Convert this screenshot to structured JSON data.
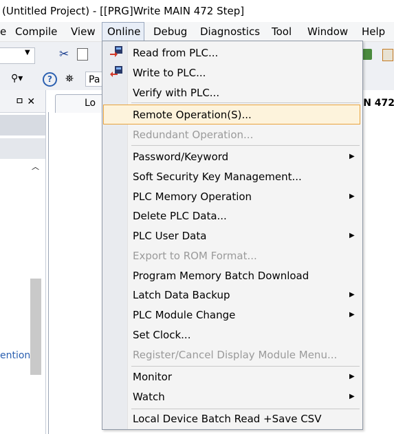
{
  "window": {
    "title": "(Untitled Project) - [[PRG]Write MAIN 472 Step]"
  },
  "menubar": {
    "items": [
      {
        "label": "e",
        "underline": ""
      },
      {
        "label": "Compile",
        "underline": "C"
      },
      {
        "label": "View",
        "underline": "V"
      },
      {
        "label": "Online",
        "underline": "O"
      },
      {
        "label": "Debug",
        "underline": "b"
      },
      {
        "label": "Diagnostics",
        "underline": "D"
      },
      {
        "label": "Tool",
        "underline": "T"
      },
      {
        "label": "Window",
        "underline": "W"
      },
      {
        "label": "Help",
        "underline": "H"
      }
    ]
  },
  "toolbar": {
    "pa_text": "Pa"
  },
  "editor": {
    "left_tab_label": "Lo",
    "right_tab_label": "IN 472"
  },
  "left_pane": {
    "header_icons": "ㅁ ✕",
    "partial_text": "ention"
  },
  "online_menu": [
    {
      "label": "Read from PLC...",
      "type": "item",
      "disabled": false,
      "submenu": false,
      "icon": "read-from-plc-icon"
    },
    {
      "label": "Write to PLC...",
      "type": "item",
      "disabled": false,
      "submenu": false,
      "icon": "write-to-plc-icon"
    },
    {
      "label": "Verify with PLC...",
      "type": "item",
      "disabled": false,
      "submenu": false,
      "icon": ""
    },
    {
      "type": "separator"
    },
    {
      "label": "Remote Operation(S)...",
      "type": "item",
      "disabled": false,
      "submenu": false,
      "highlighted": true
    },
    {
      "label": "Redundant Operation...",
      "type": "item",
      "disabled": true,
      "submenu": false
    },
    {
      "type": "separator"
    },
    {
      "label": "Password/Keyword",
      "type": "item",
      "disabled": false,
      "submenu": true
    },
    {
      "label": "Soft Security Key Management...",
      "type": "item",
      "disabled": false,
      "submenu": false
    },
    {
      "label": "PLC Memory Operation",
      "type": "item",
      "disabled": false,
      "submenu": true
    },
    {
      "label": "Delete PLC Data...",
      "type": "item",
      "disabled": false,
      "submenu": false
    },
    {
      "label": "PLC User Data",
      "type": "item",
      "disabled": false,
      "submenu": true
    },
    {
      "label": "Export to ROM Format...",
      "type": "item",
      "disabled": true,
      "submenu": false
    },
    {
      "label": "Program Memory Batch Download",
      "type": "item",
      "disabled": false,
      "submenu": false
    },
    {
      "label": "Latch Data Backup",
      "type": "item",
      "disabled": false,
      "submenu": true
    },
    {
      "label": "PLC Module Change",
      "type": "item",
      "disabled": false,
      "submenu": true
    },
    {
      "label": "Set Clock...",
      "type": "item",
      "disabled": false,
      "submenu": false
    },
    {
      "label": "Register/Cancel Display Module Menu...",
      "type": "item",
      "disabled": true,
      "submenu": false
    },
    {
      "type": "separator"
    },
    {
      "label": "Monitor",
      "type": "item",
      "disabled": false,
      "submenu": true
    },
    {
      "label": "Watch",
      "type": "item",
      "disabled": false,
      "submenu": true
    },
    {
      "type": "separator"
    },
    {
      "label": "Local Device Batch Read +Save CSV",
      "type": "item",
      "disabled": false,
      "submenu": false
    }
  ],
  "colors": {
    "highlight_border": "#e9a23a",
    "highlight_fill": "#fdf3dc",
    "disabled_text": "#9a9a9a"
  }
}
